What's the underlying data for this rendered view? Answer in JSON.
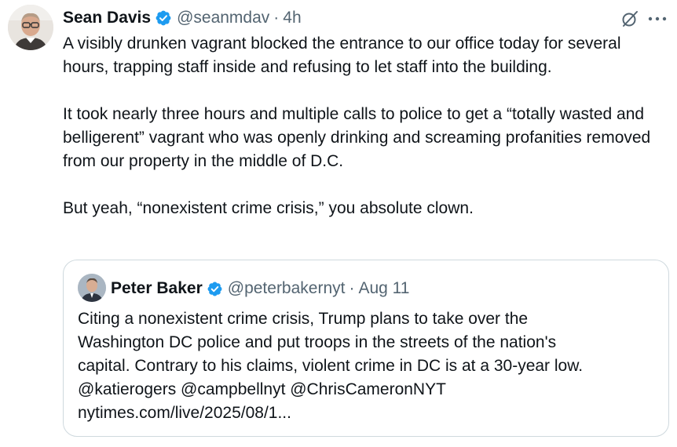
{
  "tweet": {
    "author_name": "Sean Davis",
    "handle": "@seanmdav",
    "separator": "·",
    "time": "4h",
    "paragraphs": [
      "A visibly drunken vagrant blocked the entrance to our office today for several hours, trapping staff inside and refusing to let staff into the building.",
      "It took nearly three hours and multiple calls to police to get a “totally wasted and belligerent” vagrant who was openly drinking and screaming profanities removed from our property in the middle of D.C.",
      "But yeah, “nonexistent crime crisis,” you absolute clown."
    ]
  },
  "quoted_tweet": {
    "author_name": "Peter Baker",
    "handle": "@peterbakernyt",
    "separator": "·",
    "time": "Aug 11",
    "lines": [
      "Citing a nonexistent crime crisis, Trump plans to take over the",
      "Washington DC police and put troops in the streets of the nation's",
      "capital. Contrary to his claims, violent crime in DC is at a 30-year low.",
      "@katierogers @campbellnyt @ChrisCameronNYT",
      "nytimes.com/live/2025/08/1..."
    ]
  },
  "icons": {
    "verified": "verified-badge-icon",
    "grok": "grok-icon",
    "more": "more-icon"
  },
  "colors": {
    "verified": "#1d9bf0",
    "text": "#0f1419",
    "secondary": "#536471",
    "border": "#cfd9de"
  }
}
